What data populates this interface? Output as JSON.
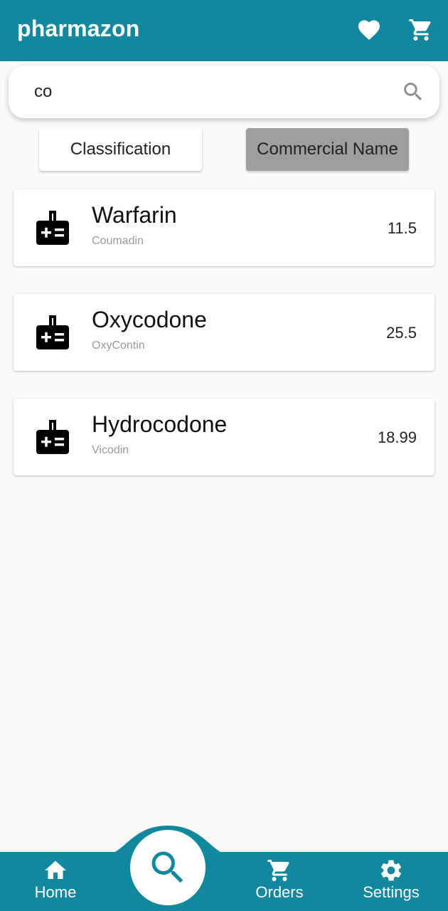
{
  "appbar": {
    "title": "pharmazon",
    "icons": [
      "heart-icon",
      "cart-icon"
    ]
  },
  "search": {
    "value": "co",
    "placeholder": ""
  },
  "filters": {
    "classification_label": "Classification",
    "commercial_label": "Commercial Name",
    "selected": "Commercial Name"
  },
  "results": [
    {
      "name": "Warfarin",
      "brand": "Coumadin",
      "price": "11.5"
    },
    {
      "name": "Oxycodone",
      "brand": "OxyContin",
      "price": "25.5"
    },
    {
      "name": "Hydrocodone",
      "brand": "Vicodin",
      "price": "18.99"
    }
  ],
  "nav": {
    "home_label": "Home",
    "orders_label": "Orders",
    "settings_label": "Settings",
    "active": "search"
  },
  "colors": {
    "primary": "#12889f",
    "selected_filter": "#9e9e9e"
  }
}
